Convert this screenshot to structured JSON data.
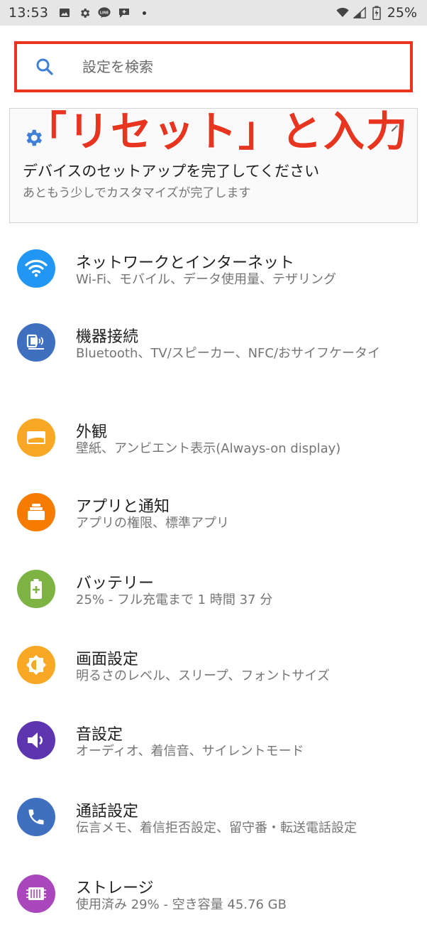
{
  "status_bar": {
    "time": "13:53",
    "left_icons": [
      "image-icon",
      "gear-icon",
      "line-app-icon",
      "chat-icon",
      "dot-icon"
    ],
    "battery_percent": "25%"
  },
  "search": {
    "placeholder": "設定を検索",
    "border_color": "#e8351f"
  },
  "annotation": {
    "text": "「リセット」と入力",
    "color": "#e8351f"
  },
  "suggestion_card": {
    "title": "デバイスのセットアップを完了してください",
    "subtitle": "あともう少しでカスタマイズが完了します"
  },
  "settings": [
    {
      "title": "ネットワークとインターネット",
      "subtitle": "Wi-Fi、モバイル、データ使用量、テザリング",
      "icon": "wifi-icon",
      "color": "#2196f3"
    },
    {
      "title": "機器接続",
      "subtitle": "Bluetooth、TV/スピーカー、NFC/おサイフケータイ",
      "icon": "devices-icon",
      "color": "#3f6fbf"
    },
    {
      "title": "外観",
      "subtitle": "壁紙、アンビエント表示(Always-on display)",
      "icon": "wallpaper-icon",
      "color": "#f9a825"
    },
    {
      "title": "アプリと通知",
      "subtitle": "アプリの権限、標準アプリ",
      "icon": "apps-icon",
      "color": "#f57c00"
    },
    {
      "title": "バッテリー",
      "subtitle": "25% - フル充電まで 1 時間 37 分",
      "icon": "battery-icon",
      "color": "#7cb342"
    },
    {
      "title": "画面設定",
      "subtitle": "明るさのレベル、スリープ、フォントサイズ",
      "icon": "brightness-icon",
      "color": "#f9a825"
    },
    {
      "title": "音設定",
      "subtitle": "オーディオ、着信音、サイレントモード",
      "icon": "volume-icon",
      "color": "#5e35b1"
    },
    {
      "title": "通話設定",
      "subtitle": "伝言メモ、着信拒否設定、留守番・転送電話設定",
      "icon": "phone-icon",
      "color": "#3f6fbf"
    },
    {
      "title": "ストレージ",
      "subtitle": "使用済み 29% - 空き容量 45.76 GB",
      "icon": "storage-icon",
      "color": "#ab47bc"
    }
  ]
}
